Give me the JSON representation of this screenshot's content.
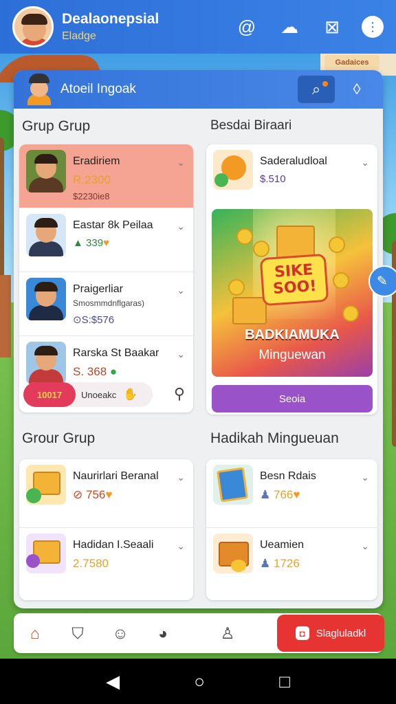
{
  "header": {
    "title": "Dealaonepsial",
    "subtitle": "Eladge",
    "icons": [
      "swirl-icon",
      "cloud-gear-icon",
      "image-icon",
      "menu-dots-icon"
    ]
  },
  "background": {
    "badge_label": "Gadaices"
  },
  "panel": {
    "title": "Atoeil Ingoak",
    "left_section_title": "Grup Grup",
    "right_section_title": "Besdai Biraari",
    "left_items": [
      {
        "name": "Eradiriem",
        "price": "R.2300",
        "sub": "$2230ie8",
        "highlight": true
      },
      {
        "name": "Eastar 8k Peilaa",
        "price": "339"
      },
      {
        "name": "Praigerliar",
        "sub": "Smosmmdnflgaras)",
        "price": "S:$576"
      },
      {
        "name": "Rarska St Baakar",
        "price": "S. 368"
      }
    ],
    "coupon": {
      "tag": "10017",
      "text": "Unoeakc"
    },
    "right_top": {
      "name": "Saderaludloal",
      "price": "$.510"
    },
    "promo": {
      "burst_line1": "SIKE",
      "burst_line2": "SOO!",
      "title": "BADKIAMUKA",
      "sub": "Minguewan",
      "button": "Seoia"
    },
    "bottom_left_title": "Grour Grup",
    "bottom_right_title": "Hadikah Mingueuan",
    "bottom_left_items": [
      {
        "name": "Naurirlari Beranal",
        "price": "756"
      },
      {
        "name": "Hadidan I.Seaali",
        "price": "2.7580"
      }
    ],
    "bottom_right_items": [
      {
        "name": "Besn Rdais",
        "price": "766"
      },
      {
        "name": "Ueamien",
        "price": "1726"
      }
    ]
  },
  "bottom_nav": {
    "items": [
      "home-icon",
      "shield-icon",
      "chat-icon",
      "globe-icon",
      "user-icon"
    ],
    "cta_label": "Slagluladkl"
  },
  "colors": {
    "primary": "#2d6fd8",
    "accent": "#e53431",
    "highlight": "#f5a392"
  }
}
